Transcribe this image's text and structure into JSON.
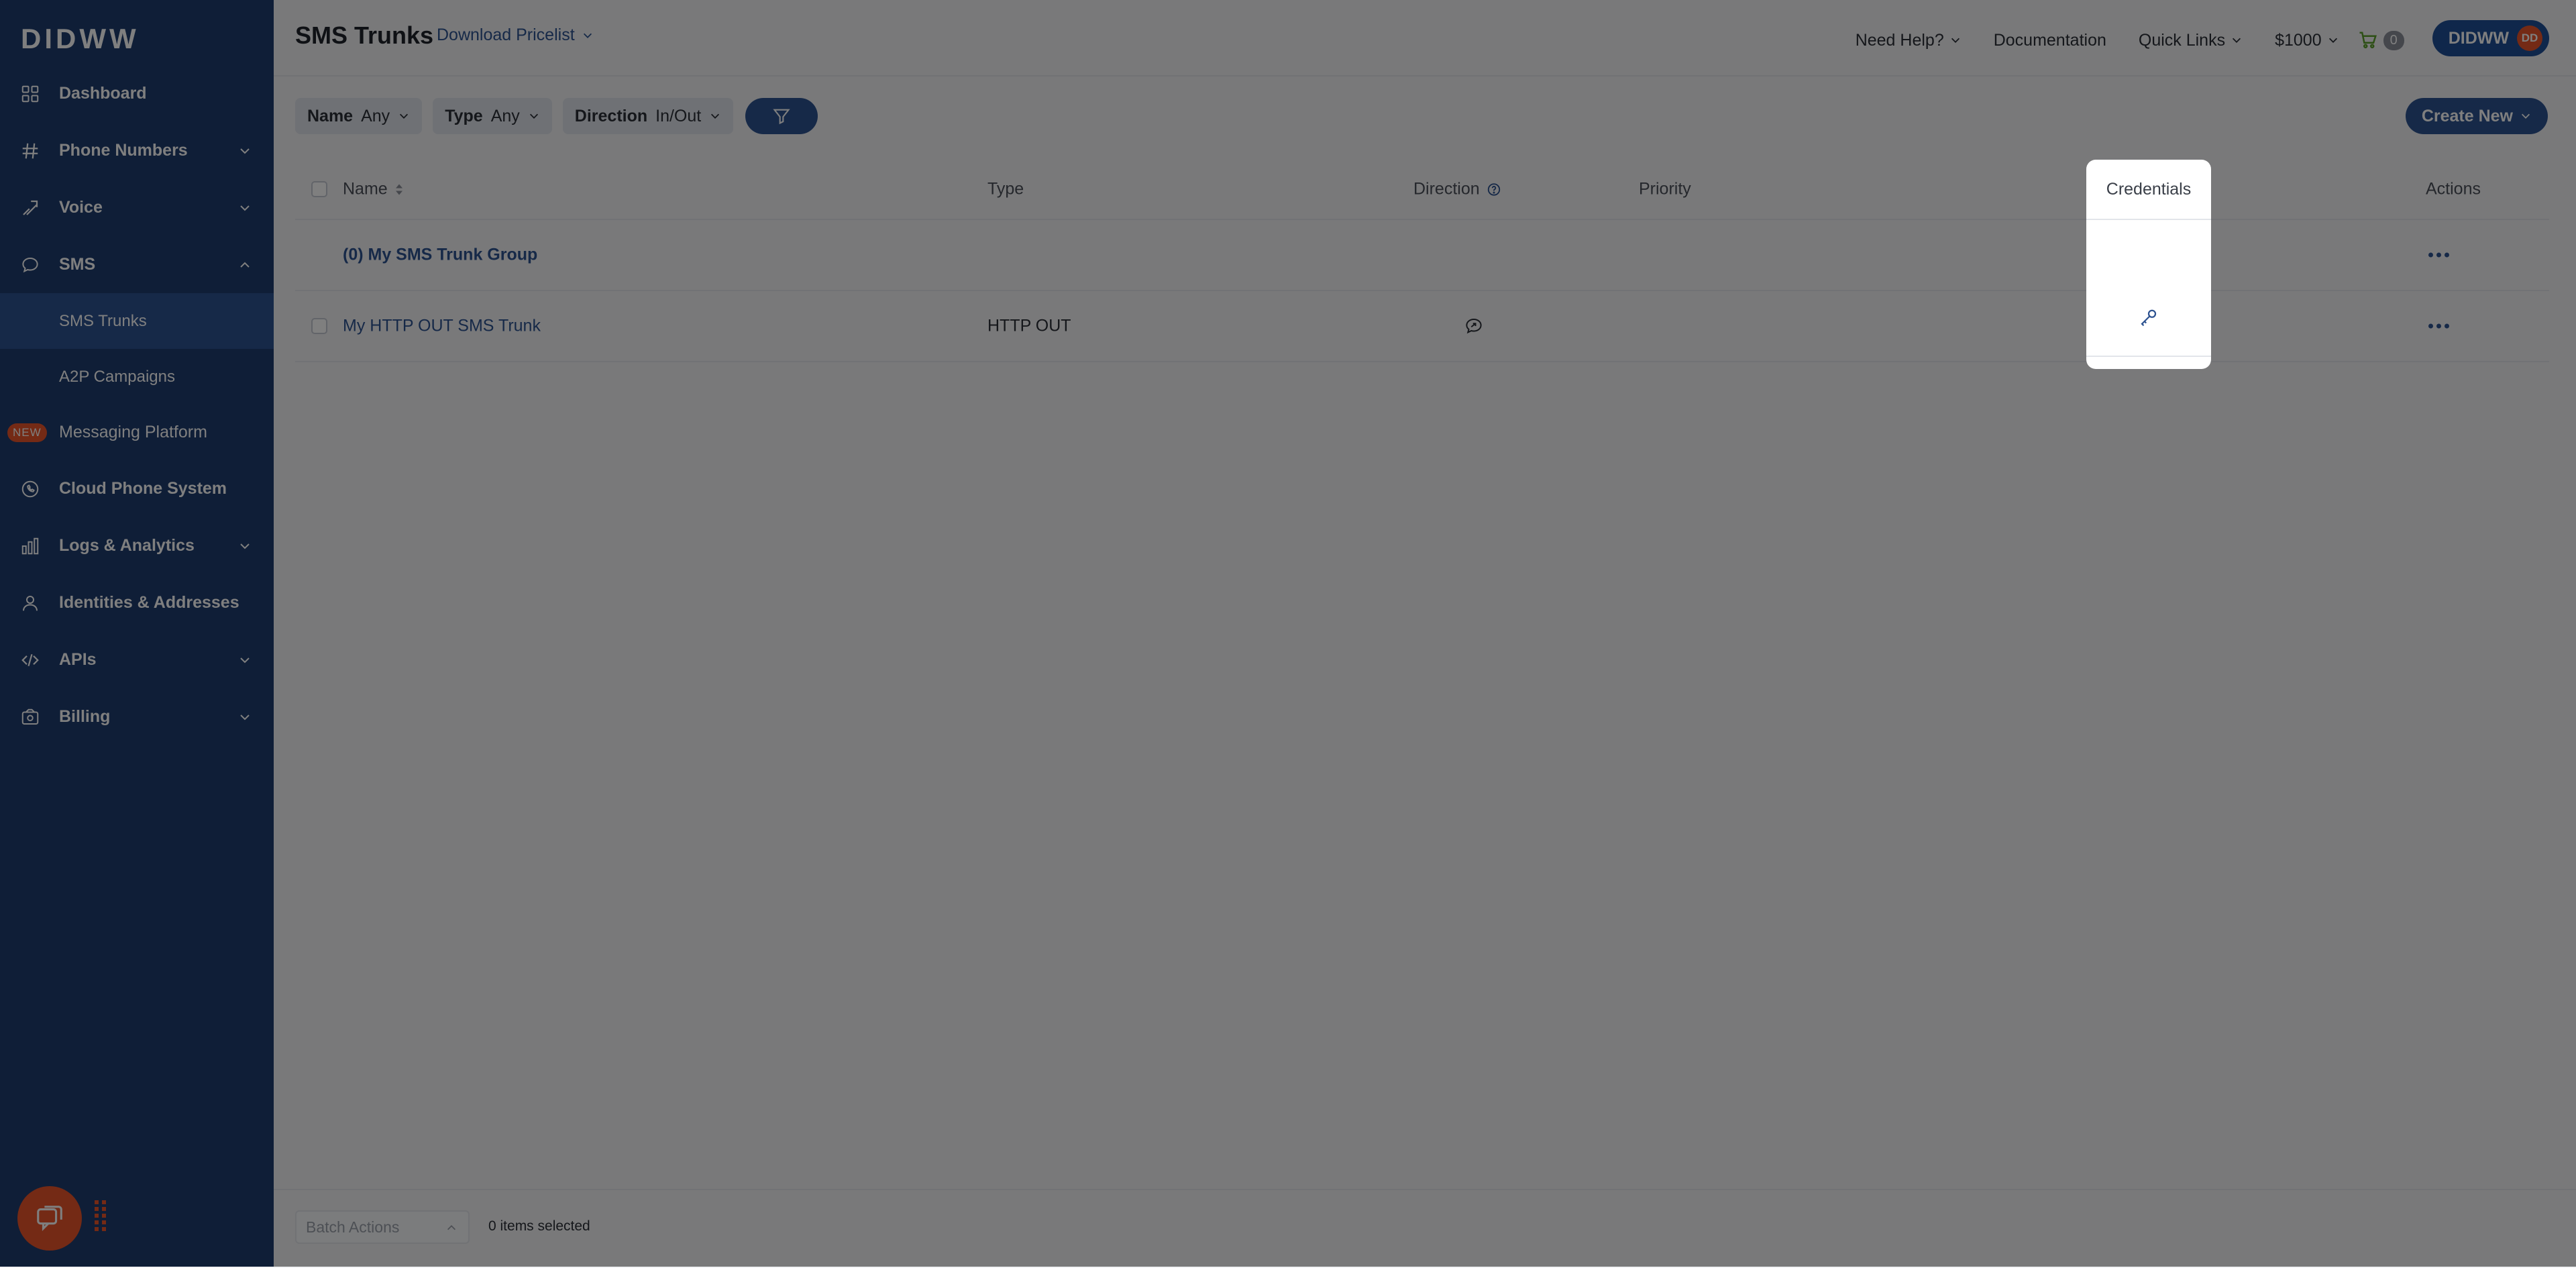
{
  "brand": {
    "logo_bold": "DID",
    "logo_rest": "WW"
  },
  "sidebar": {
    "items": [
      {
        "label": "Dashboard",
        "icon": "grid-icon"
      },
      {
        "label": "Phone Numbers",
        "icon": "hash-icon"
      },
      {
        "label": "Voice",
        "icon": "voice-icon"
      },
      {
        "label": "SMS",
        "icon": "message-icon"
      },
      {
        "label": "SMS Trunks"
      },
      {
        "label": "A2P Campaigns"
      },
      {
        "label": "Messaging Platform",
        "badge": "NEW"
      },
      {
        "label": "Cloud Phone System",
        "icon": "phone-icon"
      },
      {
        "label": "Logs & Analytics",
        "icon": "bar-chart-icon"
      },
      {
        "label": "Identities & Addresses",
        "icon": "person-icon"
      },
      {
        "label": "APIs",
        "icon": "code-icon"
      },
      {
        "label": "Billing",
        "icon": "wallet-icon"
      }
    ]
  },
  "header": {
    "title": "SMS Trunks",
    "pricelist": "Download Pricelist",
    "need_help": "Need Help?",
    "documentation": "Documentation",
    "quick_links": "Quick Links",
    "balance": "$1000",
    "cart_count": "0",
    "user": "DIDWW",
    "avatar_initials": "DD"
  },
  "filters": {
    "name_label": "Name",
    "name_value": "Any",
    "type_label": "Type",
    "type_value": "Any",
    "direction_label": "Direction",
    "direction_value": "In/Out"
  },
  "create_new": "Create New",
  "table": {
    "columns": {
      "name": "Name",
      "type": "Type",
      "direction": "Direction",
      "priority": "Priority",
      "credentials": "Credentials",
      "actions": "Actions"
    },
    "rows": [
      {
        "name": "(0) My SMS Trunk Group",
        "type": "",
        "group": true
      },
      {
        "name": "My HTTP OUT SMS Trunk",
        "type": "HTTP OUT",
        "group": false
      }
    ]
  },
  "footer": {
    "batch_actions": "Batch Actions",
    "selected": "0 items selected"
  },
  "colors": {
    "sidebar": "#1f3c6e",
    "accent": "#2d5290",
    "orange": "#e8542a"
  }
}
